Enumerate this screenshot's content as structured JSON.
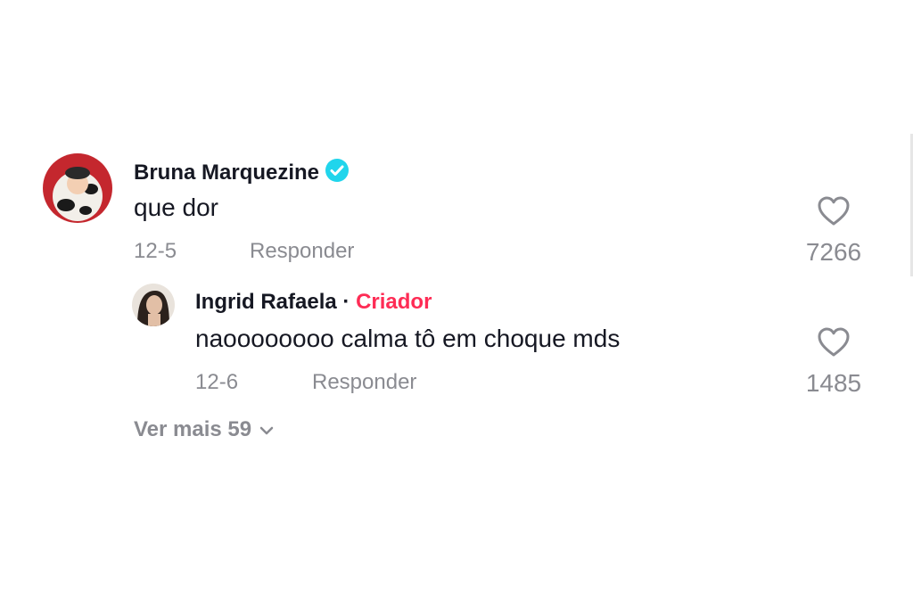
{
  "comments": [
    {
      "username": "Bruna Marquezine",
      "verified": true,
      "text": "que dor",
      "date": "12-5",
      "reply_label": "Responder",
      "likes": "7266"
    }
  ],
  "reply": {
    "username": "Ingrid Rafaela",
    "separator": "·",
    "badge": "Criador",
    "text": "naoooooooo calma tô em choque mds",
    "date": "12-6",
    "reply_label": "Responder",
    "likes": "1485"
  },
  "view_more": {
    "label": "Ver mais 59"
  },
  "colors": {
    "verified": "#20d5ec",
    "creator_badge": "#fe2c55",
    "secondary_text": "#8a8b91"
  },
  "icons": {
    "like": "heart-outline-icon",
    "verified": "verified-check-icon",
    "expand": "chevron-down-icon"
  }
}
